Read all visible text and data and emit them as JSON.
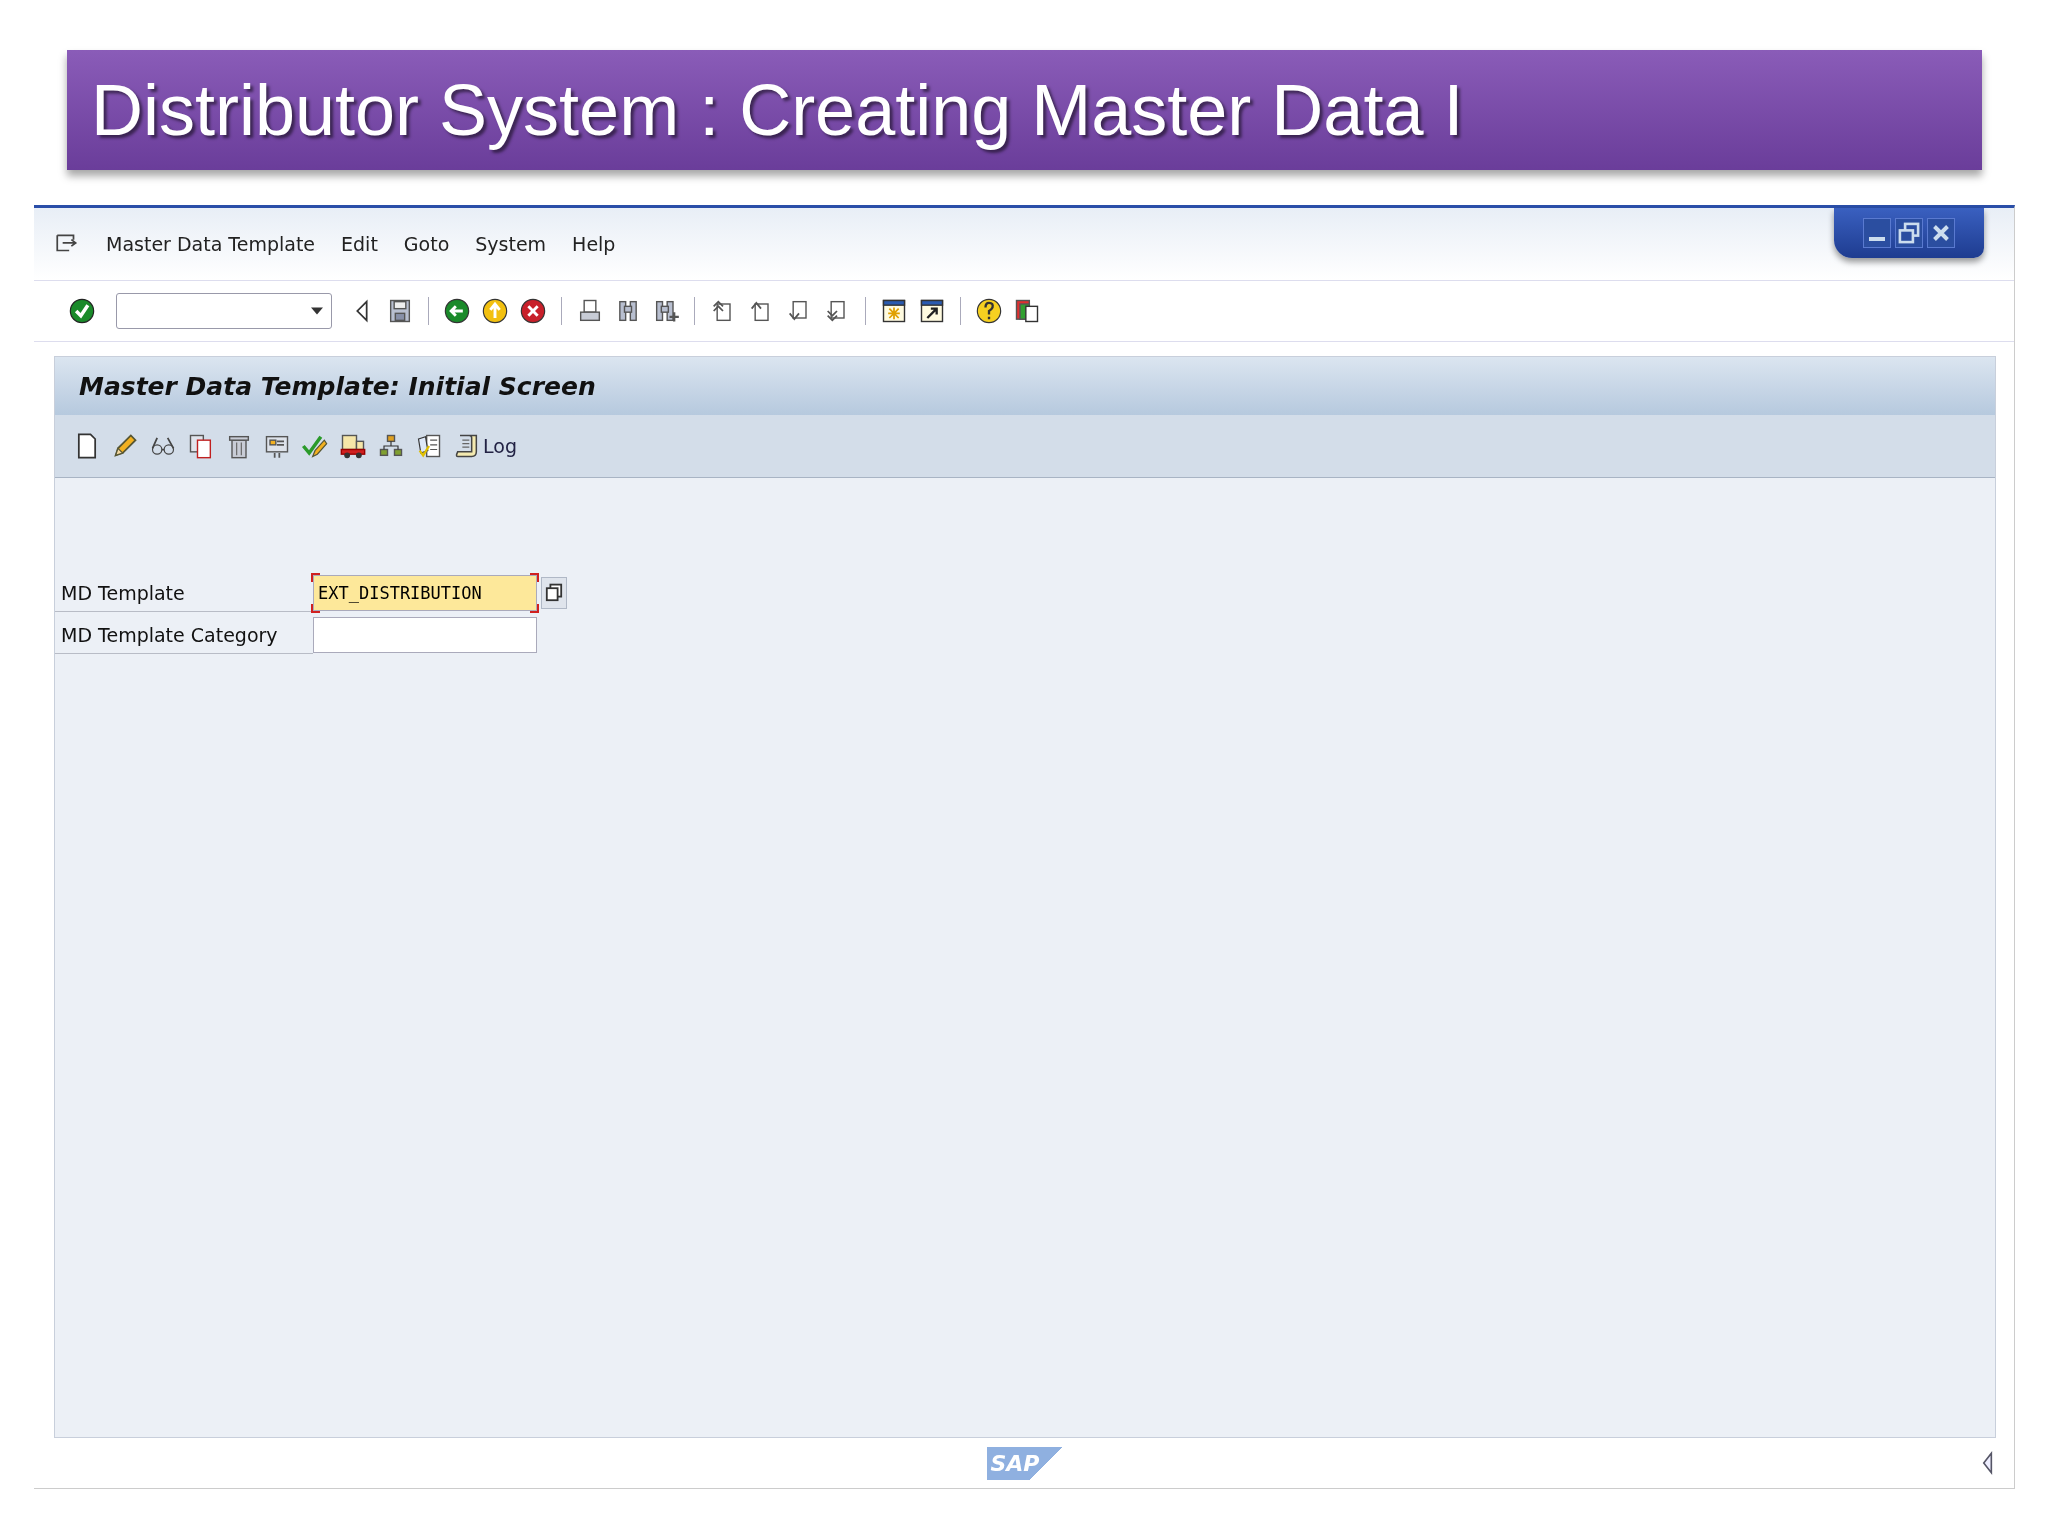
{
  "slide_title": "Distributor System : Creating Master Data I",
  "menu": [
    "Master Data Template",
    "Edit",
    "Goto",
    "System",
    "Help"
  ],
  "screen_title": "Master Data Template: Initial Screen",
  "log_button": "Log",
  "fields": [
    {
      "label": "MD Template",
      "value": "EXT_DISTRIBUTION",
      "focused": true
    },
    {
      "label": "MD Template Category",
      "focused": false
    }
  ],
  "footer_logo": "SAP"
}
